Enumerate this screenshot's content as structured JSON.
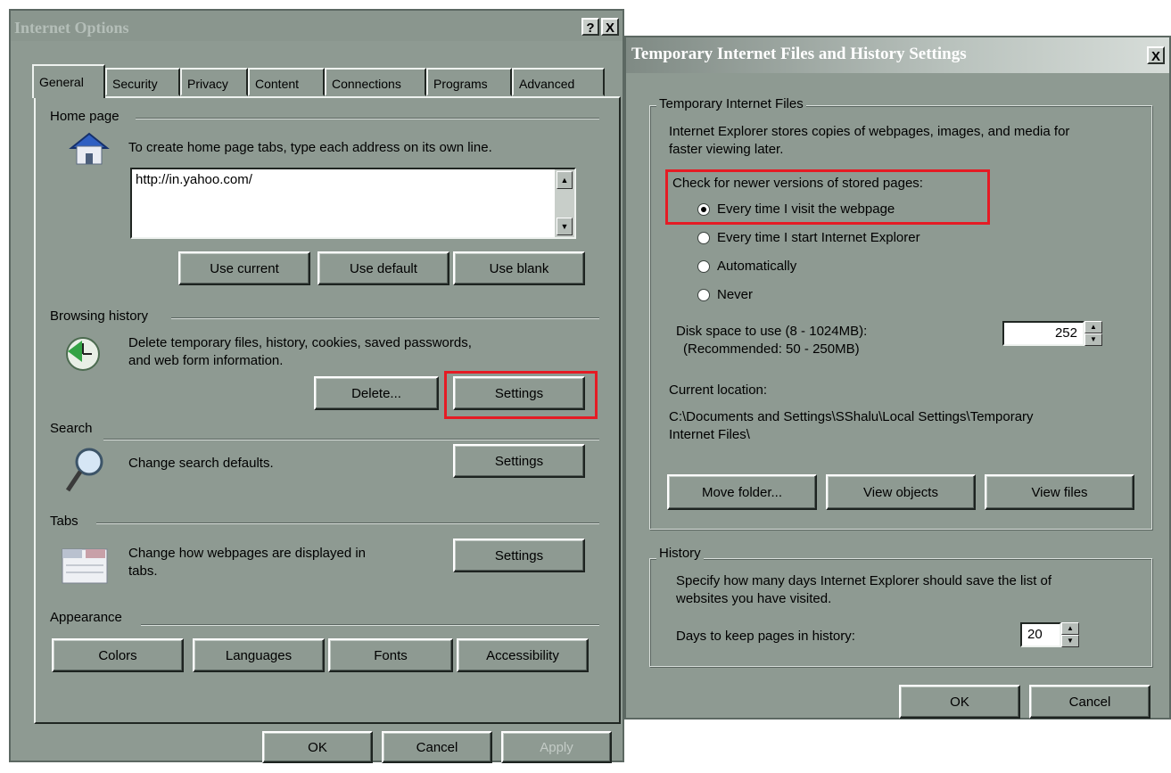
{
  "internet_options": {
    "title": "Internet Options",
    "help_button": "?",
    "close_button": "X",
    "tabs": [
      "General",
      "Security",
      "Privacy",
      "Content",
      "Connections",
      "Programs",
      "Advanced"
    ],
    "active_tab": "General",
    "home_page": {
      "label": "Home page",
      "description": "To create home page tabs, type each address on its own line.",
      "value": "http://in.yahoo.com/",
      "buttons": [
        "Use current",
        "Use default",
        "Use blank"
      ]
    },
    "browsing_history": {
      "label": "Browsing history",
      "description_line1": "Delete temporary files, history, cookies, saved passwords,",
      "description_line2": "and web form information.",
      "delete_button": "Delete...",
      "settings_button": "Settings"
    },
    "search": {
      "label": "Search",
      "description": "Change search defaults.",
      "settings_button": "Settings"
    },
    "tabs_section": {
      "label": "Tabs",
      "description_line1": "Change how webpages are displayed in",
      "description_line2": "tabs.",
      "settings_button": "Settings"
    },
    "appearance": {
      "label": "Appearance",
      "buttons": [
        "Colors",
        "Languages",
        "Fonts",
        "Accessibility"
      ]
    },
    "footer": {
      "ok": "OK",
      "cancel": "Cancel",
      "apply": "Apply"
    }
  },
  "temp_files_settings": {
    "title": "Temporary Internet Files and History Settings",
    "close_button": "X",
    "temp_files": {
      "group_label": "Temporary Internet Files",
      "description_line1": "Internet Explorer stores copies of webpages, images, and media for",
      "description_line2": "faster viewing later.",
      "check_label": "Check for newer versions of stored pages:",
      "options": [
        "Every time I visit the webpage",
        "Every time I start Internet Explorer",
        "Automatically",
        "Never"
      ],
      "selected_option": "Every time I visit the webpage",
      "disk_space_label_line1": "Disk space to use (8 - 1024MB):",
      "disk_space_label_line2": "(Recommended: 50 - 250MB)",
      "disk_space_value": "252",
      "current_location_label": "Current location:",
      "location_line1": "C:\\Documents and Settings\\SShalu\\Local Settings\\Temporary",
      "location_line2": "Internet Files\\",
      "buttons": [
        "Move folder...",
        "View objects",
        "View files"
      ]
    },
    "history": {
      "group_label": "History",
      "description_line1": "Specify how many days Internet Explorer should save the list of",
      "description_line2": "websites you have visited.",
      "days_label": "Days to keep pages in history:",
      "days_value": "20"
    },
    "footer": {
      "ok": "OK",
      "cancel": "Cancel"
    }
  },
  "colors": {
    "highlight": "#e51b24",
    "dialog_bg": "#8e9a92"
  }
}
